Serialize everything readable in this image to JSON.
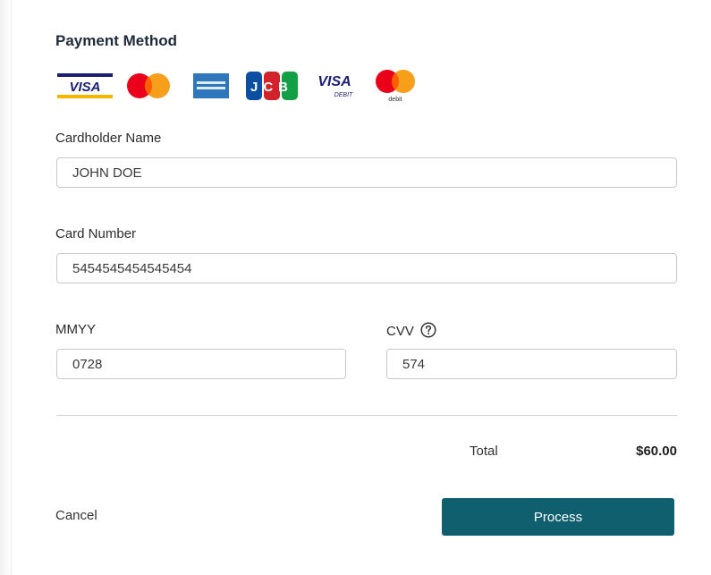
{
  "payment": {
    "heading": "Payment Method",
    "card_logos": [
      {
        "icon": "visa-logo-icon",
        "text": "VISA"
      },
      {
        "icon": "mastercard-logo-icon"
      },
      {
        "icon": "amex-logo-icon"
      },
      {
        "icon": "jcb-logo-icon",
        "text": "JCB"
      },
      {
        "icon": "visa-debit-logo-icon",
        "text": "VISA",
        "subtext": "DEBIT"
      },
      {
        "icon": "mastercard-debit-logo-icon",
        "subtext": "debit"
      }
    ]
  },
  "form": {
    "cardholder_label": "Cardholder Name",
    "cardholder_value": "JOHN DOE",
    "card_number_label": "Card Number",
    "card_number_value": "5454545454545454",
    "mmyy_label": "MMYY",
    "mmyy_value": "0728",
    "cvv_label": "CVV",
    "cvv_value": "574",
    "cvv_help_icon": "question-circle-icon"
  },
  "summary": {
    "total_label": "Total",
    "total_value": "$60.00"
  },
  "actions": {
    "cancel_label": "Cancel",
    "process_label": "Process"
  },
  "colors": {
    "primary_button": "#0f5f6f",
    "visa_blue": "#1a1f71",
    "mastercard_red": "#eb001b",
    "mastercard_orange": "#f79e1b",
    "amex_blue": "#2e77bc"
  }
}
